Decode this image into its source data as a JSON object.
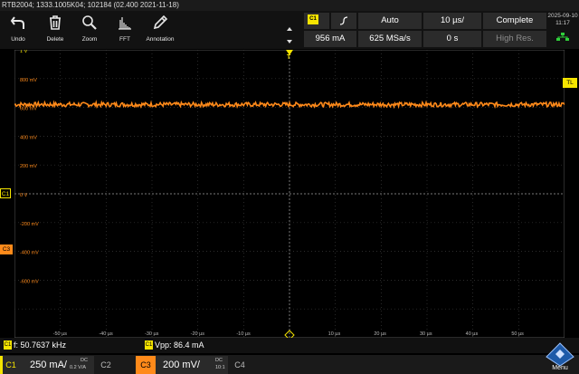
{
  "title": "RTB2004; 1333.1005K04; 102184 (02.400 2021-11-18)",
  "toolbar": [
    {
      "label": "Undo",
      "icon": "undo-icon"
    },
    {
      "label": "Delete",
      "icon": "trash-icon"
    },
    {
      "label": "Zoom",
      "icon": "zoom-icon"
    },
    {
      "label": "FFT",
      "icon": "fft-icon"
    },
    {
      "label": "Annotation",
      "icon": "pencil-icon"
    }
  ],
  "acquisition": {
    "trigger_source": "C1",
    "trigger_level": "956 mA",
    "mode": "Auto",
    "sample_rate": "625 MSa/s",
    "timebase": "10 µs/",
    "offset": "0 s",
    "status": "Complete",
    "resolution": "High Res."
  },
  "clock": {
    "date": "2025-09-10",
    "time": "11:17"
  },
  "axis": {
    "y_labels": [
      "1.2 V",
      "1 V",
      "800 mV",
      "600 mV",
      "400 mV",
      "200 mV",
      "0 V",
      "-200 mV",
      "-400 mV",
      "-600 mV"
    ],
    "x_labels": [
      "-50 µs",
      "-40 µs",
      "-30 µs",
      "-20 µs",
      "-10 µs",
      "10 µs",
      "20 µs",
      "30 µs",
      "40 µs",
      "50 µs"
    ],
    "c1_marker": "C1",
    "c3_marker": "C3",
    "tl_marker": "TL",
    "trigger_marker": "T"
  },
  "measurements": {
    "freq": {
      "badge": "C1",
      "text": "f: 50.7637 kHz"
    },
    "vpp": {
      "badge": "C1",
      "text": "Vpp: 86.4 mA"
    }
  },
  "channels": {
    "c1": {
      "name": "C1",
      "scale": "250 mA/",
      "coupling": "DC",
      "probe": "0.2 V/A"
    },
    "c2": {
      "name": "C2"
    },
    "c3": {
      "name": "C3",
      "scale": "200 mV/",
      "coupling": "DC",
      "probe": "10:1"
    },
    "c4": {
      "name": "C4"
    }
  },
  "menu_label": "Menu",
  "colors": {
    "c1": "#f5e400",
    "c3": "#ff8a1a",
    "grid": "#3a3a3a",
    "background": "#000000",
    "panel": "#2b2b2b"
  },
  "waveform": {
    "c1_level_v": 1.08,
    "c1_ripple_v": 0.03,
    "c1_cycles": 5,
    "c3_level_v": 0.62,
    "c3_noise_v": 0.015
  }
}
